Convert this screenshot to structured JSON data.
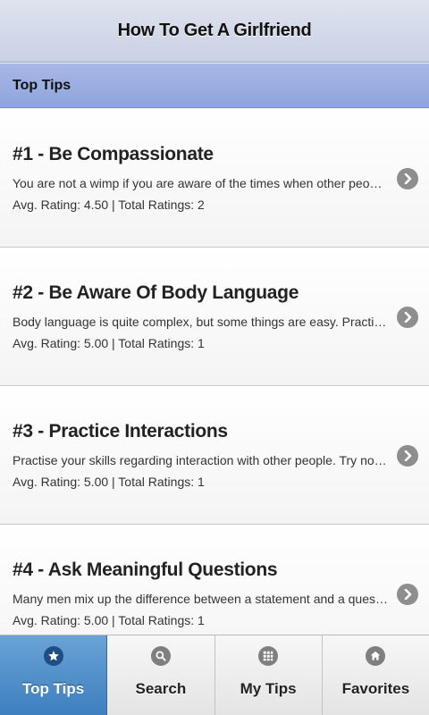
{
  "header": {
    "title": "How To Get A Girlfriend"
  },
  "section": {
    "title": "Top Tips"
  },
  "tips": [
    {
      "title": "#1 - Be Compassionate",
      "description": "You are not a wimp if you are aware of the times when other people need you...",
      "rating": "Avg. Rating: 4.50 | Total Ratings: 2"
    },
    {
      "title": "#2 - Be Aware Of Body Language",
      "description": "Body language is quite complex, but some things are easy. Practise on your f...",
      "rating": "Avg. Rating: 5.00 | Total Ratings: 1"
    },
    {
      "title": "#3 - Practice Interactions",
      "description": "Practise your skills regarding interaction with other people. Try not to brag all t...",
      "rating": "Avg. Rating: 5.00 | Total Ratings: 1"
    },
    {
      "title": "#4 - Ask Meaningful Questions",
      "description": "Many men mix up the difference between a statement and a question, yet the ...",
      "rating": "Avg. Rating: 5.00 | Total Ratings: 1"
    }
  ],
  "tabs": [
    {
      "label": "Top Tips",
      "icon": "star-icon",
      "active": true
    },
    {
      "label": "Search",
      "icon": "search-icon",
      "active": false
    },
    {
      "label": "My Tips",
      "icon": "grid-icon",
      "active": false
    },
    {
      "label": "Favorites",
      "icon": "home-icon",
      "active": false
    }
  ],
  "colors": {
    "header_bg": "#c8d1e4",
    "section_bg": "#8fa4dc",
    "active_tab": "#3d7fbf"
  }
}
